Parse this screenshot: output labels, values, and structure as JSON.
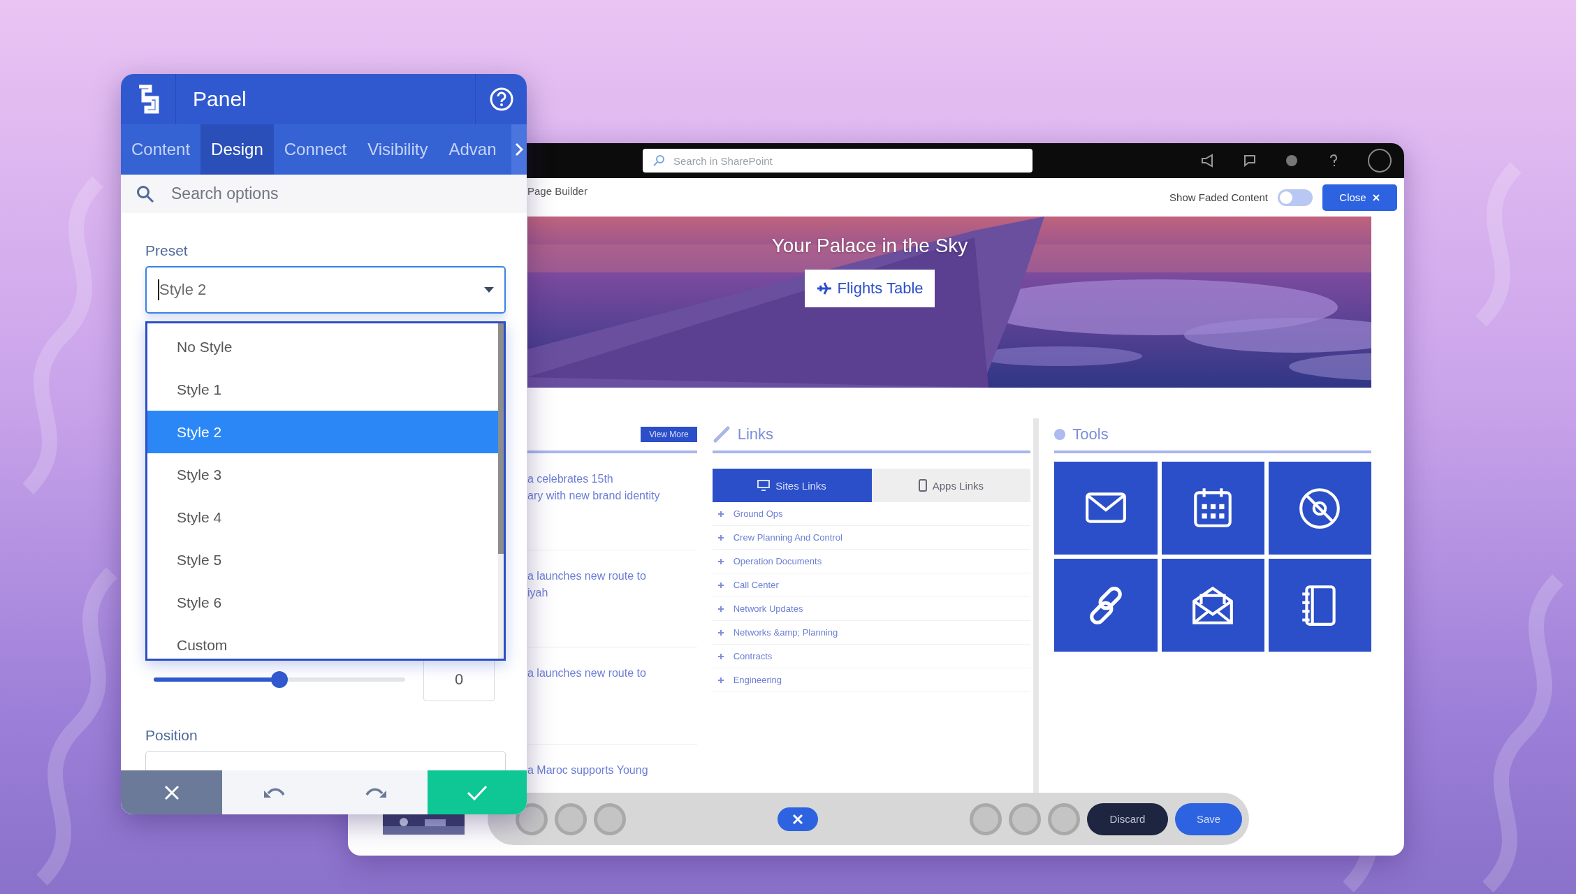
{
  "panel": {
    "title": "Panel",
    "tabs": [
      {
        "label": "Content",
        "selected": false
      },
      {
        "label": "Design",
        "selected": true
      },
      {
        "label": "Connect",
        "selected": false
      },
      {
        "label": "Visibility",
        "selected": false
      },
      {
        "label": "Advan",
        "selected": false
      }
    ],
    "search": {
      "placeholder": "Search options"
    },
    "preset": {
      "label": "Preset",
      "value": "Style 2",
      "options": [
        {
          "label": "No Style",
          "selected": false
        },
        {
          "label": "Style 1",
          "selected": false
        },
        {
          "label": "Style 2",
          "selected": true
        },
        {
          "label": "Style 3",
          "selected": false
        },
        {
          "label": "Style 4",
          "selected": false
        },
        {
          "label": "Style 5",
          "selected": false
        },
        {
          "label": "Style 6",
          "selected": false
        },
        {
          "label": "Custom",
          "selected": false
        }
      ]
    },
    "slider": {
      "level": 0.5,
      "value": "0"
    },
    "position": {
      "label": "Position"
    }
  },
  "background_app": {
    "search": {
      "placeholder": "Search in SharePoint"
    },
    "breadcrumb": "Page Builder",
    "faded_toggle": {
      "label": "Show Faded Content",
      "on": false
    },
    "close_button": "Close",
    "hero": {
      "title": "Your Palace in the Sky",
      "button": "Flights Table"
    },
    "news": {
      "button": "View More",
      "items": [
        {
          "lines": [
            "a celebrates 15th",
            "ary with new brand identity"
          ]
        },
        {
          "lines": [
            "a launches new route to",
            "iyah"
          ]
        },
        {
          "lines": [
            "a launches new route to"
          ]
        },
        {
          "lines": [
            "a Maroc supports Young"
          ]
        }
      ]
    },
    "links": {
      "title": "Links",
      "tabs": [
        {
          "label": "Sites Links",
          "selected": true
        },
        {
          "label": "Apps Links",
          "selected": false
        }
      ],
      "items": [
        "Ground Ops",
        "Crew Planning And Control",
        "Operation Documents",
        "Call Center",
        "Network Updates",
        "Networks &amp; Planning",
        "Contracts",
        "Engineering"
      ]
    },
    "tools": {
      "title": "Tools"
    },
    "toolbar": {
      "discard": "Discard",
      "save": "Save"
    }
  }
}
